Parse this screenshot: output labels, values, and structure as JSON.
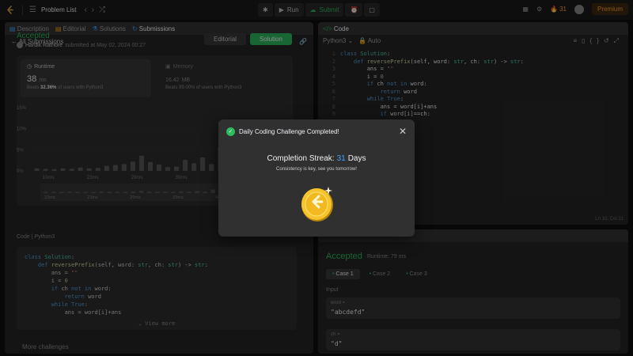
{
  "topbar": {
    "problem_list": "Problem List",
    "run": "Run",
    "submit": "Submit",
    "streak_count": "31",
    "premium": "Premium"
  },
  "left": {
    "tabs": [
      "Description",
      "Editorial",
      "Solutions",
      "Submissions"
    ],
    "back": "All Submissions",
    "status": "Accepted",
    "author": "Hardik Rathore",
    "submitted": "submitted at May 02, 2024 00:27",
    "editorial_btn": "Editorial",
    "solution_btn": "Solution",
    "runtime_label": "Runtime",
    "runtime_value": "38",
    "runtime_unit": "ms",
    "runtime_beats_pct": "32.36%",
    "runtime_beats_text": "of users with Python3",
    "memory_label": "Memory",
    "memory_value": "16.42",
    "memory_unit": "MB",
    "memory_beats_pct": "99.00%",
    "memory_beats_text": "of users with Python3",
    "code_header": "Code",
    "code_lang": "Python3",
    "view_more": "View more",
    "more_challenges": "More challenges"
  },
  "chart_data": {
    "type": "bar",
    "yticks": [
      "15%",
      "10%",
      "5%",
      "0%"
    ],
    "xticks": [
      "10ms",
      "23ms",
      "29ms",
      "39ms",
      "46ms",
      "53ms"
    ],
    "mini_xticks": [
      "10ms",
      "23ms",
      "29ms",
      "33ms",
      "46ms",
      "53ms"
    ],
    "values": [
      0.6,
      0.5,
      0.4,
      0.6,
      0.5,
      0.8,
      0.6,
      0.7,
      1.2,
      1.4,
      1.6,
      2.2,
      3.6,
      2.1,
      1.5,
      0.9,
      1.0,
      2.6,
      1.8,
      3.2,
      1.6,
      5.6,
      6.2,
      4.6,
      7.6,
      5.8,
      4.0,
      2.2,
      2.6
    ]
  },
  "code": {
    "panel_title": "Code",
    "lang": "Python3",
    "mode": "Auto",
    "cursor": "Ln 10, Col 21",
    "lines": [
      "class Solution:",
      "    def reversePrefix(self, word: str, ch: str) -> str:",
      "        ans = \"\"",
      "        i = 0",
      "        if ch not in word:",
      "            return word",
      "        while True:",
      "            ans = word[i]+ans",
      "            if word[i]==ch:"
    ]
  },
  "result": {
    "status": "Accepted",
    "runtime": "Runtime: 79 ms",
    "cases": [
      "Case 1",
      "Case 2",
      "Case 3"
    ],
    "input_label": "Input",
    "vars": [
      {
        "name": "word =",
        "value": "\"abcdefd\""
      },
      {
        "name": "ch =",
        "value": "\"d\""
      }
    ]
  },
  "modal": {
    "title": "Daily Coding Challenge Completed!",
    "streak_prefix": "Completion Streak:",
    "streak_days": "31",
    "streak_suffix": "Days",
    "tagline": "Consistency is key, see you tomorrow!"
  },
  "colors": {
    "accent_green": "#2cbb5d",
    "accent_orange": "#ffa116",
    "streak_blue": "#3ea6ff"
  }
}
